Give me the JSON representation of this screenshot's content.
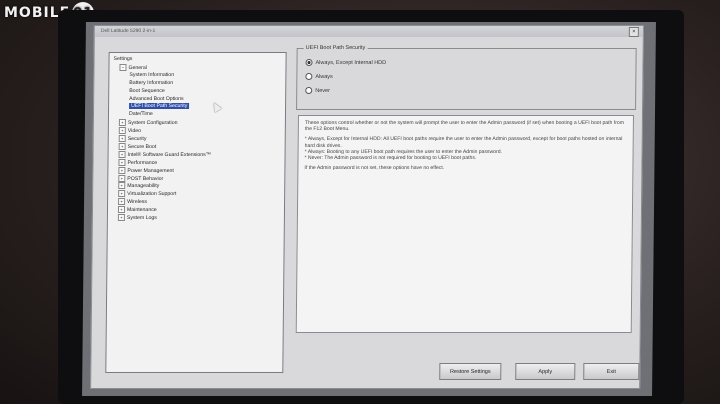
{
  "watermark": {
    "text": "MOBILE",
    "icon_glyph": "01"
  },
  "window": {
    "title": "Dell Latitude 5290 2-in-1"
  },
  "tree": {
    "items": [
      {
        "label": "Settings",
        "level": 0,
        "toggle": ""
      },
      {
        "label": "General",
        "level": 1,
        "toggle": "−"
      },
      {
        "label": "System Information",
        "level": 2,
        "toggle": ""
      },
      {
        "label": "Battery Information",
        "level": 2,
        "toggle": ""
      },
      {
        "label": "Boot Sequence",
        "level": 2,
        "toggle": ""
      },
      {
        "label": "Advanced Boot Options",
        "level": 2,
        "toggle": ""
      },
      {
        "label": "UEFI Boot Path Security",
        "level": 2,
        "toggle": "",
        "selected": true
      },
      {
        "label": "Date/Time",
        "level": 2,
        "toggle": ""
      },
      {
        "label": "System Configuration",
        "level": 1,
        "toggle": "+"
      },
      {
        "label": "Video",
        "level": 1,
        "toggle": "+"
      },
      {
        "label": "Security",
        "level": 1,
        "toggle": "+"
      },
      {
        "label": "Secure Boot",
        "level": 1,
        "toggle": "+"
      },
      {
        "label": "Intel® Software Guard Extensions™",
        "level": 1,
        "toggle": "+"
      },
      {
        "label": "Performance",
        "level": 1,
        "toggle": "+"
      },
      {
        "label": "Power Management",
        "level": 1,
        "toggle": "+"
      },
      {
        "label": "POST Behavior",
        "level": 1,
        "toggle": "+"
      },
      {
        "label": "Manageability",
        "level": 1,
        "toggle": "+"
      },
      {
        "label": "Virtualization Support",
        "level": 1,
        "toggle": "+"
      },
      {
        "label": "Wireless",
        "level": 1,
        "toggle": "+"
      },
      {
        "label": "Maintenance",
        "level": 1,
        "toggle": "+"
      },
      {
        "label": "System Logs",
        "level": 1,
        "toggle": "+"
      }
    ]
  },
  "group": {
    "title": "UEFI Boot Path Security",
    "options": [
      {
        "label": "Always, Except Internal HDD",
        "selected": true
      },
      {
        "label": "Always",
        "selected": false
      },
      {
        "label": "Never",
        "selected": false
      }
    ]
  },
  "description": {
    "para1": "These options control whether or not the system will prompt the user to enter the Admin password (if set) when booting a UEFI boot path from the F12 Boot Menu.",
    "bullet1": "* Always, Except for Internal HDD: All UEFI boot paths require the user to enter the Admin password, except for boot paths hosted on internal hard disk drives.",
    "bullet2": "* Always: Booting to any UEFI boot path requires the user to enter the Admin password.",
    "bullet3": "* Never: The Admin password is not required for booting to UEFI boot paths.",
    "para2": "If the Admin password is not set, these options have no effect."
  },
  "buttons": {
    "restore": "Restore Settings",
    "apply": "Apply",
    "exit": "Exit"
  }
}
